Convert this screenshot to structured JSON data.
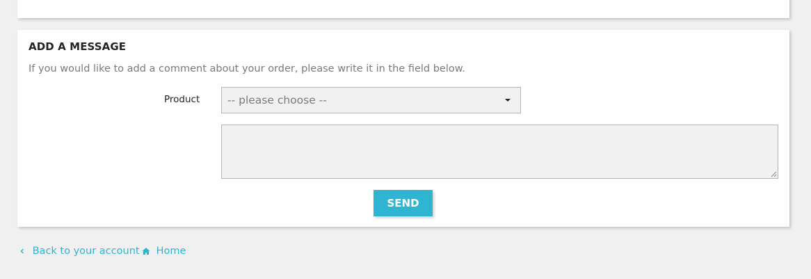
{
  "message_card": {
    "title": "ADD A MESSAGE",
    "description": "If you would like to add a comment about your order, please write it in the field below.",
    "product_label": "Product",
    "product_select": {
      "selected": "-- please choose --"
    },
    "message_textarea": {
      "value": ""
    },
    "send_label": "SEND"
  },
  "footer": {
    "back_link": "Back to your account",
    "home_link": "Home"
  },
  "colors": {
    "accent": "#2fb5d2",
    "background": "#f0f0f0",
    "card": "#ffffff",
    "field_background": "#f1f1f1"
  },
  "icons": {
    "back": "chevron-left-icon",
    "home": "home-icon",
    "select": "caret-down-icon"
  }
}
